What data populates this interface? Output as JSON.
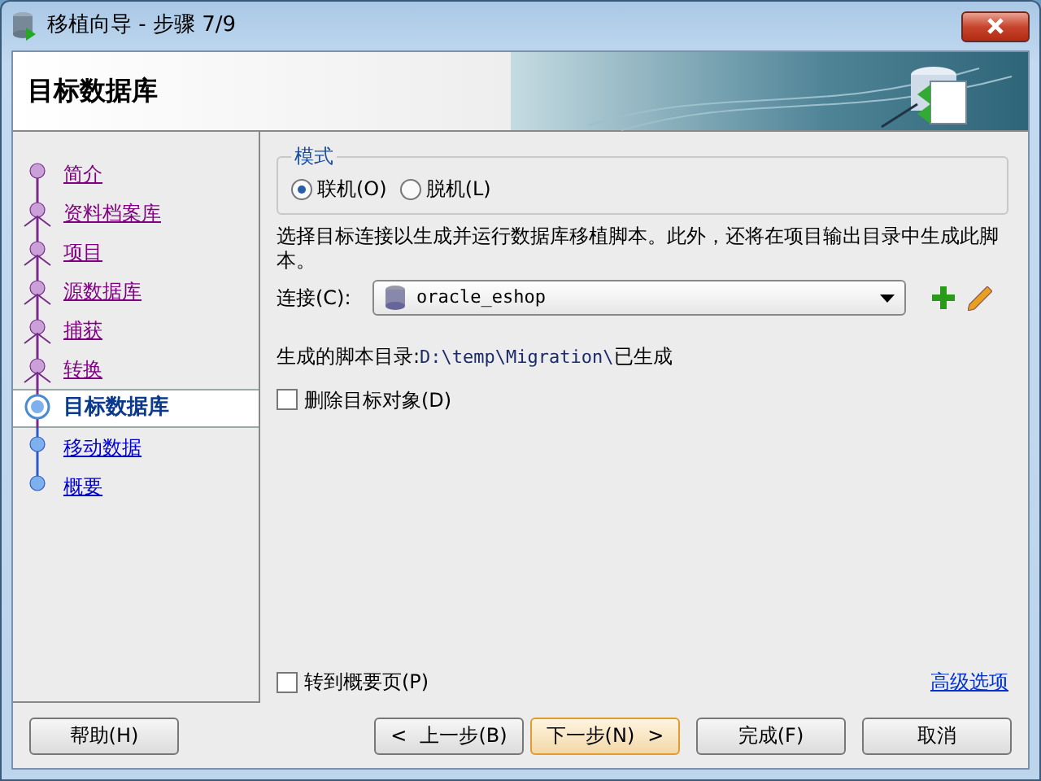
{
  "window": {
    "title": "移植向导 - 步骤 7/9"
  },
  "header": {
    "title": "目标数据库"
  },
  "steps": [
    {
      "label": "简介",
      "visited": true,
      "selected": false
    },
    {
      "label": "资料档案库",
      "visited": true,
      "selected": false
    },
    {
      "label": "项目",
      "visited": true,
      "selected": false
    },
    {
      "label": "源数据库",
      "visited": true,
      "selected": false
    },
    {
      "label": "捕获",
      "visited": true,
      "selected": false
    },
    {
      "label": "转换",
      "visited": true,
      "selected": false
    },
    {
      "label": "目标数据库",
      "visited": true,
      "selected": true
    },
    {
      "label": "移动数据",
      "visited": false,
      "selected": false
    },
    {
      "label": "概要",
      "visited": false,
      "selected": false
    }
  ],
  "mode": {
    "legend": "模式",
    "options": [
      {
        "label": "联机(O)",
        "selected": true
      },
      {
        "label": "脱机(L)",
        "selected": false
      }
    ]
  },
  "description": "选择目标连接以生成并运行数据库移植脚本。此外，还将在项目输出目录中生成此脚本。",
  "connection": {
    "label": "连接(C):",
    "value": "oracle_eshop"
  },
  "script_dir": {
    "label": "生成的脚本目录:",
    "path": "D:\\temp\\Migration\\",
    "suffix": "已生成"
  },
  "drop_objects": {
    "label": "删除目标对象(D)",
    "checked": false
  },
  "go_to_summary": {
    "label": "转到概要页(P)",
    "checked": false
  },
  "advanced_link": "高级选项",
  "buttons": [
    {
      "label": "帮助(H)",
      "kind": "help",
      "default": false
    },
    {
      "label": "上一步(B)",
      "kind": "back",
      "arrow": "<",
      "default": false
    },
    {
      "label": "下一步(N)",
      "kind": "next",
      "arrow": ">",
      "default": true
    },
    {
      "label": "完成(F)",
      "kind": "finish",
      "default": false
    },
    {
      "label": "取消",
      "kind": "cancel",
      "default": false
    }
  ]
}
